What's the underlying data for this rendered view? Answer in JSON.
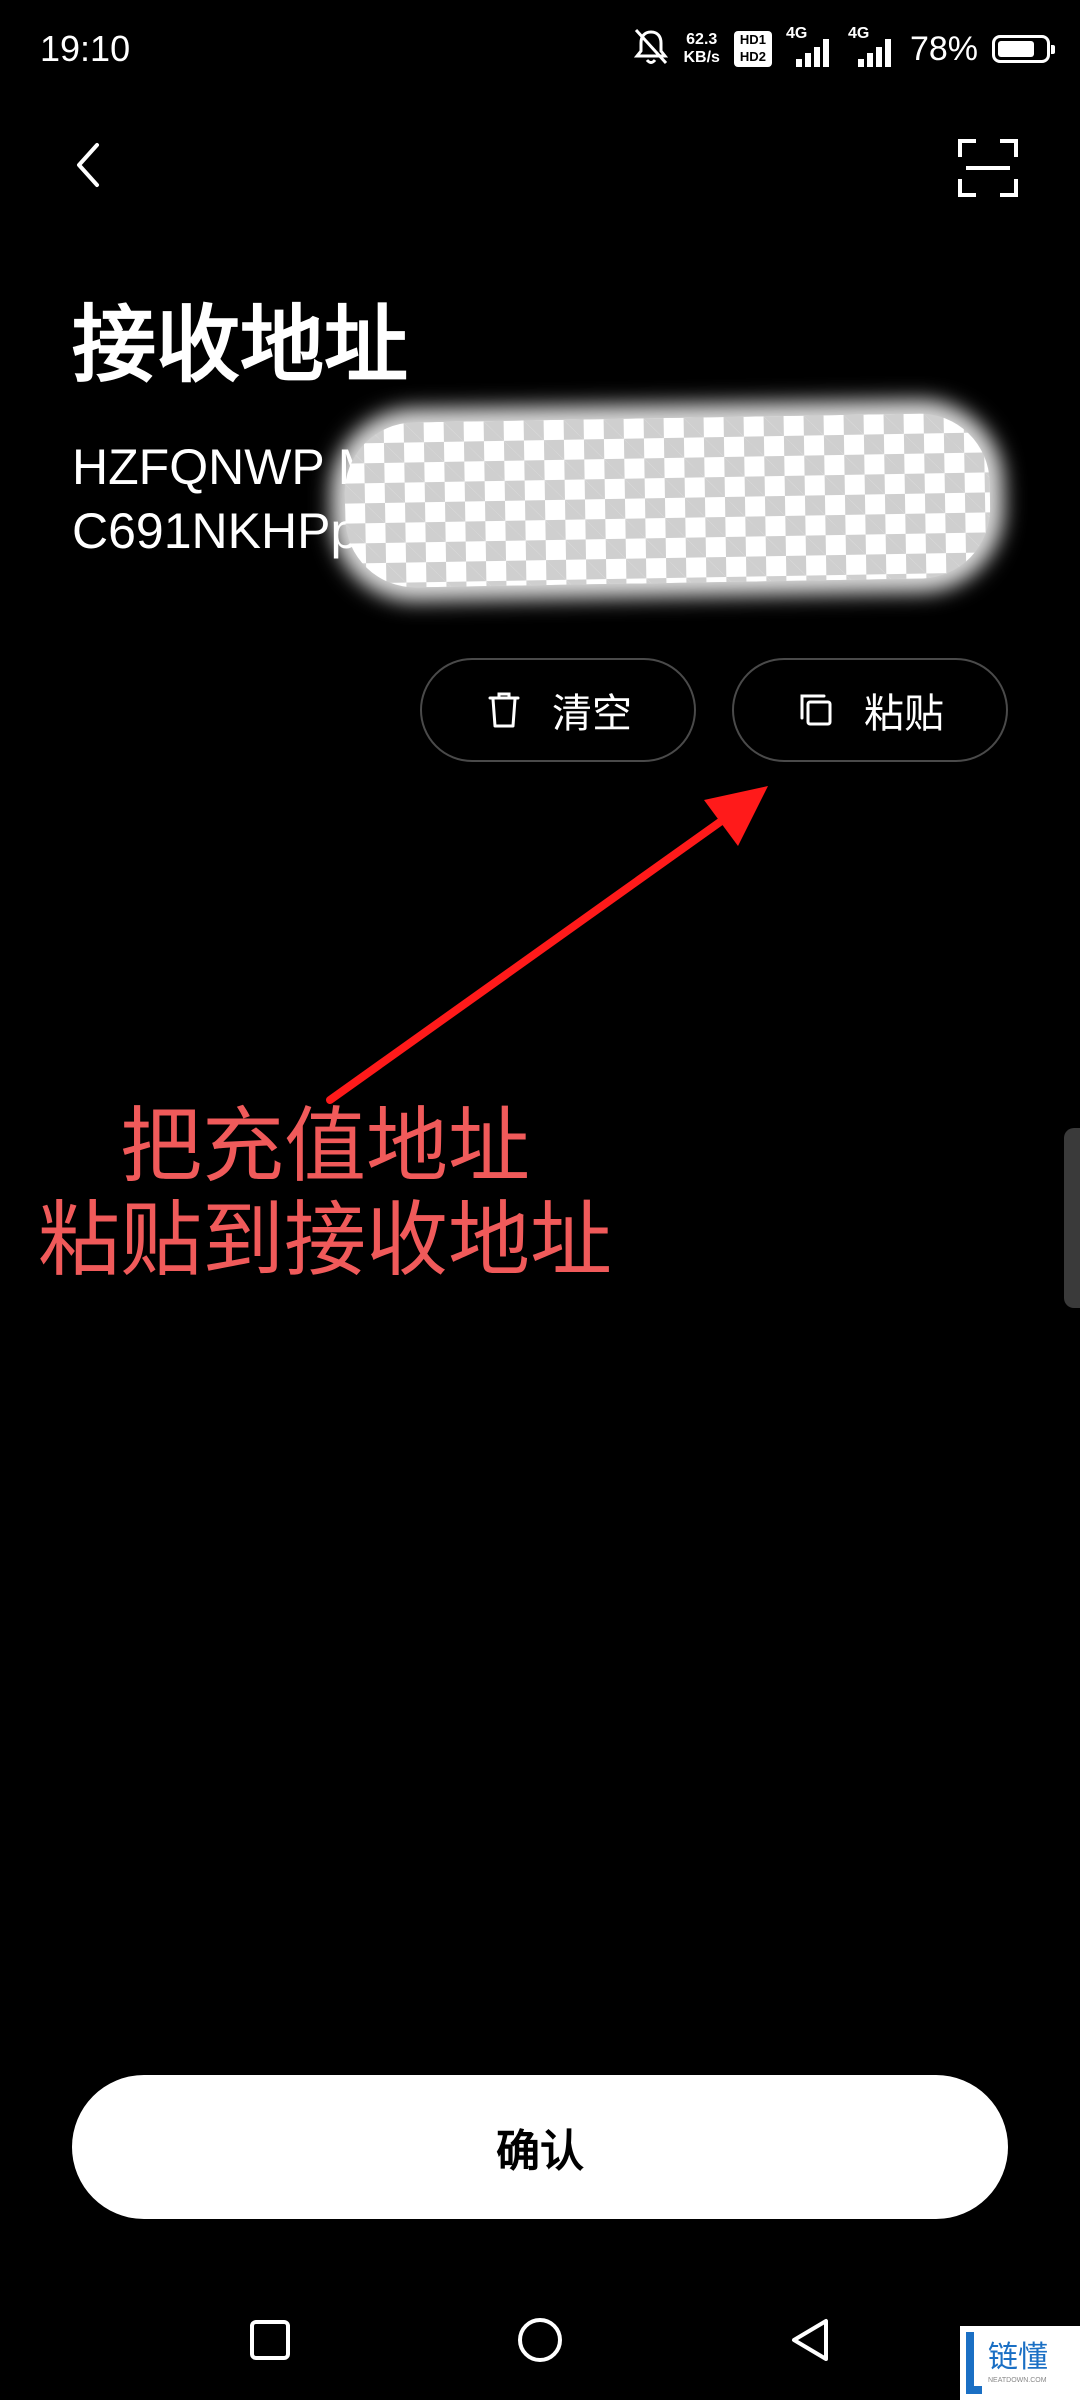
{
  "status_bar": {
    "time": "19:10",
    "net_speed_value": "62.3",
    "net_speed_unit": "KB/s",
    "hd_top": "HD1",
    "hd_bottom": "HD2",
    "sim1_label": "4G",
    "sim2_label": "4G",
    "battery_percent": "78%",
    "battery_level": 0.78,
    "icons": [
      "bell-off-icon",
      "hd-icon",
      "signal-icon",
      "battery-icon"
    ]
  },
  "header": {
    "back_icon": "chevron-left-icon",
    "scan_icon": "scan-icon"
  },
  "page": {
    "title": "接收地址",
    "address_visible": "HZFQNWP                                   MQQf5\nC691NKHPpk",
    "address_redacted": true
  },
  "actions": {
    "clear_label": "清空",
    "clear_icon": "trash-icon",
    "paste_label": "粘贴",
    "paste_icon": "copy-icon"
  },
  "annotation": {
    "line1": "把充值地址",
    "line2": "粘贴到接收地址",
    "color": "#f05a5a",
    "arrow_color": "#ff1a1a"
  },
  "footer": {
    "confirm_label": "确认"
  },
  "nav": {
    "icons": [
      "square-icon",
      "circle-icon",
      "triangle-back-icon"
    ]
  },
  "watermark": {
    "text": "链懂",
    "subtext": "NEATDOWN.COM"
  }
}
